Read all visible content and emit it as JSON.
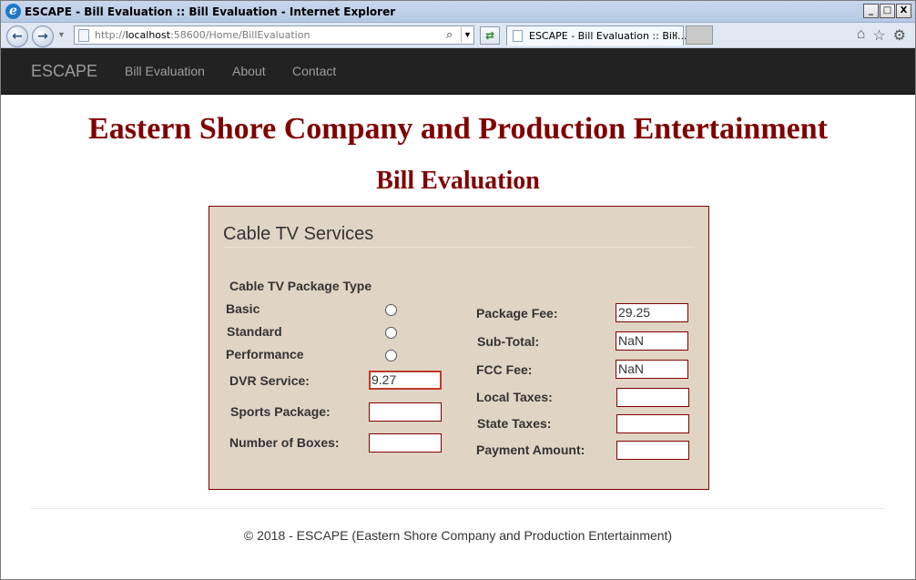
{
  "window": {
    "title": "ESCAPE - Bill Evaluation :: Bill Evaluation - Internet Explorer",
    "minimize": "_",
    "maximize": "□",
    "close": "X"
  },
  "browser": {
    "url_prefix": "http://",
    "url_host": "localhost",
    "url_rest": ":58600/Home/BillEvaluation",
    "tab_title": "ESCAPE - Bill Evaluation :: Bill...",
    "tab_close": "×"
  },
  "navbar": {
    "brand": "ESCAPE",
    "links": [
      "Bill Evaluation",
      "About",
      "Contact"
    ]
  },
  "page": {
    "title": "Eastern Shore Company and Production Entertainment",
    "subtitle": "Bill Evaluation"
  },
  "panel": {
    "title": "Cable TV Services",
    "package_heading": "Cable TV Package Type",
    "packages": [
      "Basic",
      "Standard",
      "Performance"
    ],
    "dvr_label": "DVR Service:",
    "dvr_value": "9.27",
    "sports_label": "Sports Package:",
    "sports_value": "",
    "boxes_label": "Number of Boxes:",
    "boxes_value": "",
    "package_fee_label": "Package Fee:",
    "package_fee_value": "29.25",
    "subtotal_label": "Sub-Total:",
    "subtotal_value": "NaN",
    "fcc_label": "FCC Fee:",
    "fcc_value": "NaN",
    "local_tax_label": "Local Taxes:",
    "local_tax_value": "",
    "state_tax_label": "State Taxes:",
    "state_tax_value": "",
    "payment_label": "Payment Amount:",
    "payment_value": ""
  },
  "footer": {
    "text": "© 2018 - ESCAPE (Eastern Shore Company and Production Entertainment)"
  },
  "colors": {
    "heading": "#800000",
    "panel_bg": "#e0d4c4",
    "navbar_bg": "#222222"
  }
}
